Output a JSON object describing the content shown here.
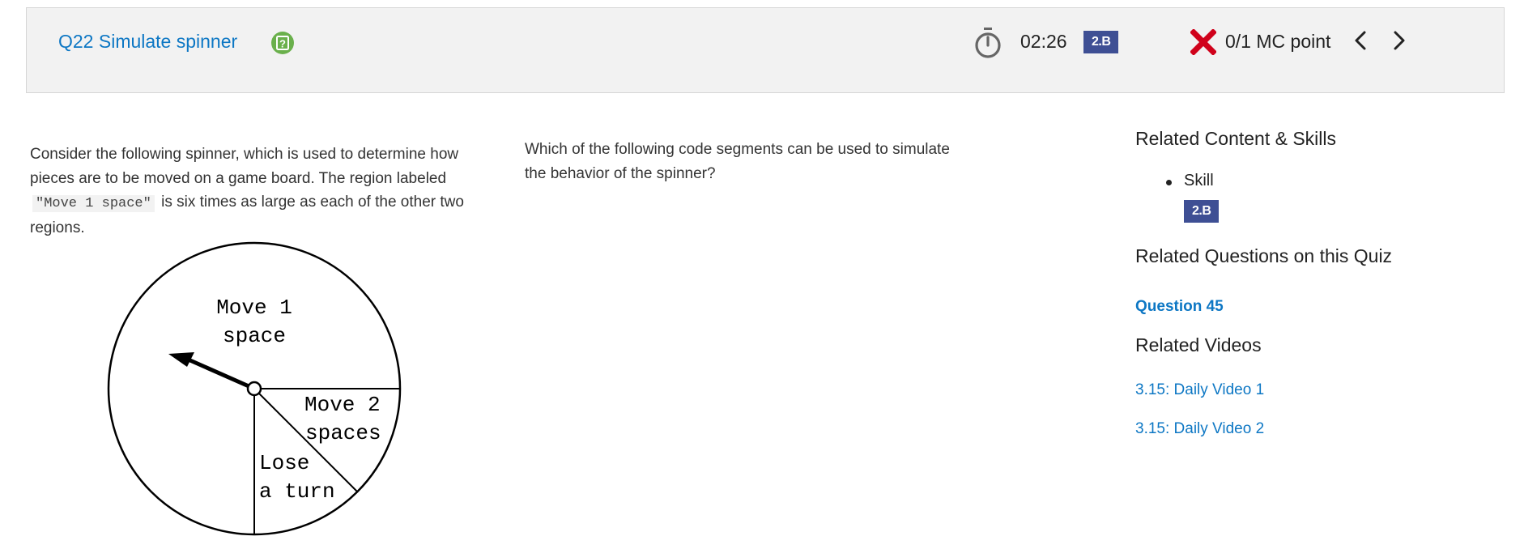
{
  "header": {
    "question_title": "Q22 Simulate spinner",
    "timer": "02:26",
    "skill_badge": "2.B",
    "score": "0/1 MC point"
  },
  "stem": {
    "part1": "Consider the following spinner, which is used to determine how pieces are to be moved on a game board. The region labeled",
    "code": "\"Move 1 space\"",
    "part2": "is six times as large as each of the other two regions."
  },
  "spinner": {
    "region_move1_line1": "Move 1",
    "region_move1_line2": "space",
    "region_move2_line1": "Move 2",
    "region_move2_line2": "spaces",
    "region_lose_line1": "Lose",
    "region_lose_line2": "a turn"
  },
  "question": {
    "prompt": "Which of the following code segments can be used to simulate the behavior of the spinner?"
  },
  "sidebar": {
    "related_content_heading": "Related Content & Skills",
    "skill_label": "Skill",
    "skill_badge": "2.B",
    "related_questions_heading": "Related Questions on this Quiz",
    "question_link": "Question 45",
    "related_videos_heading": "Related Videos",
    "videos": [
      "3.15: Daily Video 1",
      "3.15: Daily Video 2"
    ]
  },
  "colors": {
    "link": "#0d77c4",
    "badge": "#3e4f94",
    "wrong": "#d0021b",
    "help": "#6ab04c",
    "header_bg": "#f2f2f2"
  },
  "icons": [
    "help-icon",
    "timer-icon",
    "x-icon",
    "chevron-left-icon",
    "chevron-right-icon"
  ]
}
